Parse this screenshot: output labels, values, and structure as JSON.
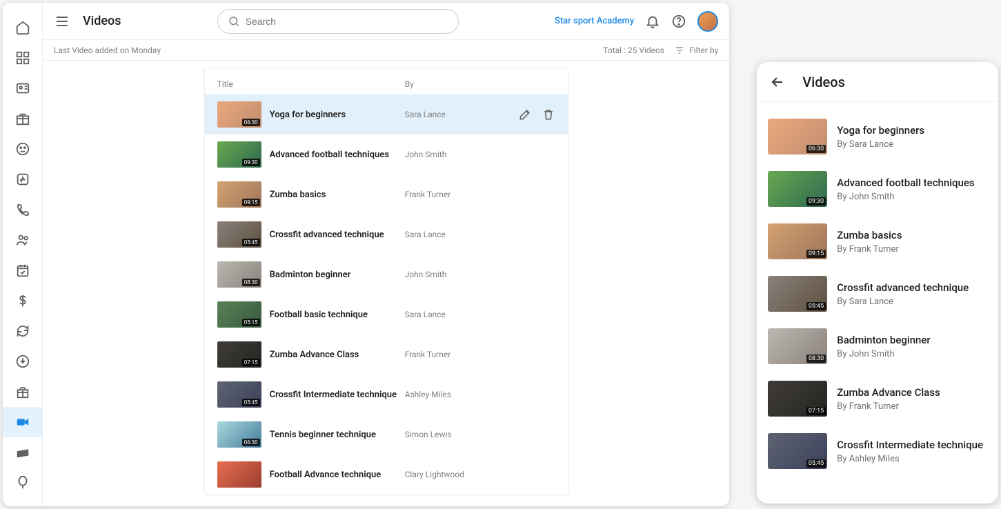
{
  "header": {
    "page_title": "Videos",
    "search_placeholder": "Search",
    "org_link": "Star sport Academy"
  },
  "subbar": {
    "last_added": "Last Video added on Monday",
    "total_label": "Total : 25 Videos",
    "filter_label": "Filter by"
  },
  "table": {
    "col_title": "Title",
    "col_by": "By",
    "rows": [
      {
        "title": "Yoga for beginners",
        "by": "Sara Lance",
        "duration": "06:30",
        "selected": true
      },
      {
        "title": "Advanced football techniques",
        "by": "John Smith",
        "duration": "09:30"
      },
      {
        "title": "Zumba basics",
        "by": "Frank Turner",
        "duration": "09:15"
      },
      {
        "title": "Crossfit advanced technique",
        "by": "Sara Lance",
        "duration": "05:45"
      },
      {
        "title": "Badminton beginner",
        "by": "John Smith",
        "duration": "08:30"
      },
      {
        "title": "Football basic technique",
        "by": "Sara Lance",
        "duration": "05:15"
      },
      {
        "title": "Zumba Advance Class",
        "by": "Frank Turner",
        "duration": "07:15"
      },
      {
        "title": "Crossfit Intermediate technique",
        "by": "Ashley Miles",
        "duration": "05:45"
      },
      {
        "title": "Tennis beginner technique",
        "by": "Simon Lewis",
        "duration": "06:30"
      },
      {
        "title": "Football Advance technique",
        "by": "Clary Lightwood",
        "duration": ""
      }
    ]
  },
  "mobile": {
    "title": "Videos",
    "by_prefix": "By ",
    "rows": [
      {
        "title": "Yoga for beginners",
        "by": "Sara Lance",
        "duration": "06:30"
      },
      {
        "title": "Advanced football techniques",
        "by": "John Smith",
        "duration": "09:30"
      },
      {
        "title": "Zumba basics",
        "by": "Frank Turner",
        "duration": "09:15"
      },
      {
        "title": "Crossfit advanced technique",
        "by": "Sara Lance",
        "duration": "05:45"
      },
      {
        "title": "Badminton beginner",
        "by": "John Smith",
        "duration": "08:30"
      },
      {
        "title": "Zumba Advance Class",
        "by": "Frank Turner",
        "duration": "07:15"
      },
      {
        "title": "Crossfit Intermediate technique",
        "by": "Ashley Miles",
        "duration": "05:45"
      }
    ]
  },
  "icons": {
    "sidebar": [
      "home-icon",
      "dashboard-icon",
      "id-card-icon",
      "gift-icon",
      "face-icon",
      "activity-icon",
      "phone-icon",
      "group-icon",
      "event-icon",
      "dollar-icon",
      "sync-icon",
      "download-icon",
      "gift2-icon",
      "video-icon",
      "card-icon",
      "balloon-icon"
    ]
  }
}
